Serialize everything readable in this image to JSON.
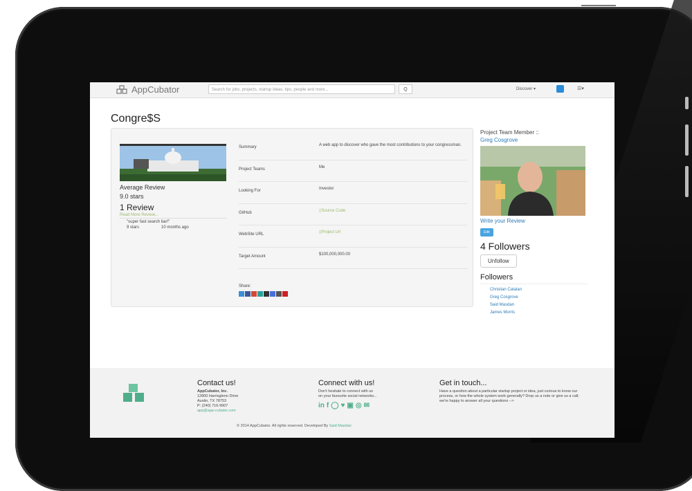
{
  "navbar": {
    "brand": "AppCubator",
    "search_placeholder": "Search for jobs, projects, startup ideas, tips, people and more...",
    "search_button": "Q",
    "discover": "Discover ▾",
    "menu": "☰▾"
  },
  "project": {
    "title": "Congre$S",
    "average_review_label": "Average Review",
    "average_review_value": "9.0 stars",
    "review_count": "1 Review",
    "read_more": "Read More Review...",
    "review_quote": "\"super fast search bar!\"",
    "review_stars": "9 stars",
    "review_time": "10 months ago",
    "fields": [
      {
        "label": "Summary",
        "value": "A web app to discover who gave the most contributions to your congressman.",
        "link": false
      },
      {
        "label": "Project Teams",
        "value": "Me",
        "link": false
      },
      {
        "label": "Looking For",
        "value": "Investor",
        "link": false
      },
      {
        "label": "GitHub",
        "value": "Source Code",
        "link": true
      },
      {
        "label": "WebSite URL",
        "value": "Project Url",
        "link": true
      },
      {
        "label": "Target Amount",
        "value": "$100,000,000.00",
        "link": false
      }
    ],
    "share_label": "Share:",
    "share_icon_colors": [
      "#3b8fd6",
      "#3b5998",
      "#d34836",
      "#2aa198",
      "#333",
      "#4a6ee0",
      "#555",
      "#cb2027"
    ]
  },
  "sidebar": {
    "member_label": "Project Team Member ::",
    "member_name": "Greg Cosgrove",
    "write_review": "Write your Review",
    "edit": "Edit",
    "followers_count": "4 Followers",
    "unfollow": "Unfollow",
    "followers_heading": "Followers",
    "followers": [
      "Christian Catalan",
      "Greg Cosgrove",
      "Said Masdan",
      "James Morris"
    ]
  },
  "footer": {
    "contact_title": "Contact us!",
    "contact_company": "AppCubator, Inc.",
    "contact_address1": "12800 Harrisglenn Drive",
    "contact_address2": "Austin, TX 78753",
    "contact_phone": "P: (240) 716-9907",
    "contact_email": "app@app-cubator.com",
    "connect_title": "Connect with us!",
    "connect_text1": "Don't hesitate to connect with us",
    "connect_text2": "on your favourite social networks...",
    "touch_title": "Get in touch...",
    "touch_text": "Have a question about a particular startup project or idea, just curious to know our process, or how the whole system work generally? Drop us a note or give us a call; we're happy to answer all your questions -->",
    "copyright": "© 2014 AppCubator. All rights reserved. Developed By",
    "author": "Said Masdan"
  },
  "colors": {
    "link_blue": "#2a7ab8",
    "accent_green": "#4fae8a",
    "link_olive": "#9bb96a"
  }
}
